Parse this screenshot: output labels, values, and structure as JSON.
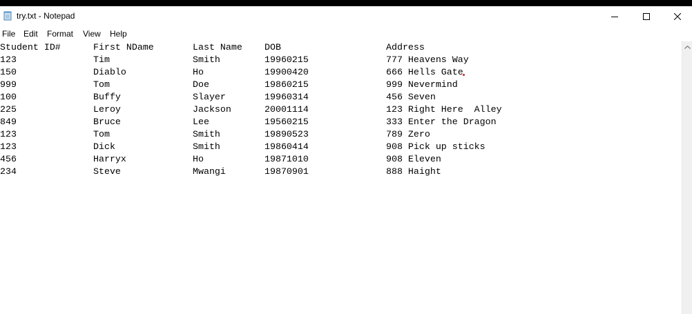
{
  "window": {
    "title": "try.txt - Notepad",
    "icons": {
      "app": "notepad-icon",
      "minimize": "minimize-icon",
      "maximize": "maximize-icon",
      "close": "close-icon"
    }
  },
  "menu": {
    "file": "File",
    "edit": "Edit",
    "format": "Format",
    "view": "View",
    "help": "Help"
  },
  "document": {
    "header": {
      "id": "Student ID#",
      "first": "First NDame",
      "last": "Last Name",
      "dob": "DOB",
      "address": "Address"
    },
    "rows": [
      {
        "id": "123",
        "first": "Tim",
        "last": "Smith",
        "dob": "19960215",
        "address": "777 Heavens Way"
      },
      {
        "id": "150",
        "first": "Diablo",
        "last": "Ho",
        "dob": "19900420",
        "address": "666 Hells Gate"
      },
      {
        "id": "999",
        "first": "Tom",
        "last": "Doe",
        "dob": "19860215",
        "address": "999 Nevermind"
      },
      {
        "id": "100",
        "first": "Buffy",
        "last": "Slayer",
        "dob": "19960314",
        "address": "456 Seven"
      },
      {
        "id": "225",
        "first": "Leroy",
        "last": "Jackson",
        "dob": "20001114",
        "address": "123 Right Here  Alley"
      },
      {
        "id": "849",
        "first": "Bruce",
        "last": "Lee",
        "dob": "19560215",
        "address": "333 Enter the Dragon"
      },
      {
        "id": "123",
        "first": "Tom",
        "last": "Smith",
        "dob": "19890523",
        "address": "789 Zero"
      },
      {
        "id": "123",
        "first": "Dick",
        "last": "Smith",
        "dob": "19860414",
        "address": "908 Pick up sticks"
      },
      {
        "id": "456",
        "first": "Harryx",
        "last": "Ho",
        "dob": "19871010",
        "address": "908 Eleven"
      },
      {
        "id": "234",
        "first": "Steve",
        "last": "Mwangi",
        "dob": "19870901",
        "address": "888 Haight"
      }
    ]
  }
}
